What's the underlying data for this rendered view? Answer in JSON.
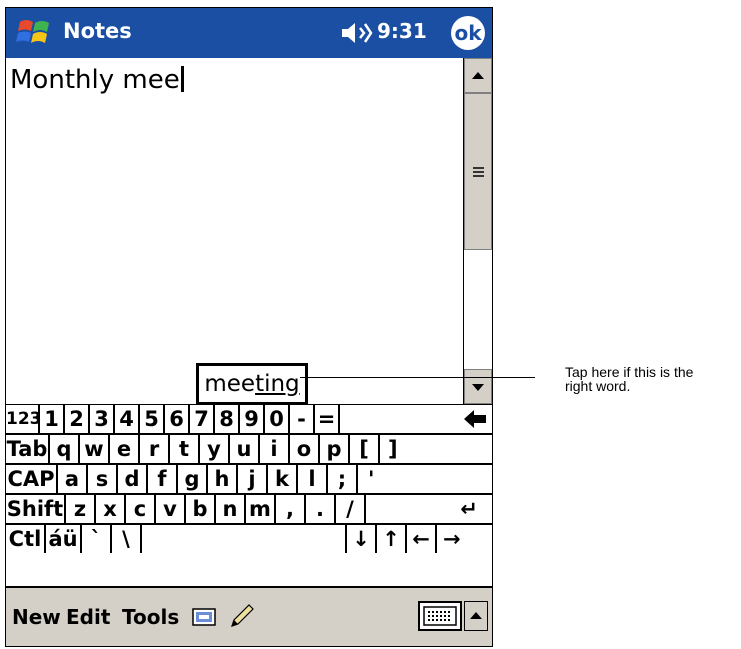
{
  "titlebar": {
    "app_title": "Notes",
    "time": "9:31",
    "ok_label": "ok"
  },
  "note": {
    "text": "Monthly mee"
  },
  "suggestion": {
    "prefix": "mee",
    "completion": "ting"
  },
  "keyboard": {
    "rows": [
      [
        "123",
        "1",
        "2",
        "3",
        "4",
        "5",
        "6",
        "7",
        "8",
        "9",
        "0",
        "-",
        "=",
        "←"
      ],
      [
        "Tab",
        "q",
        "w",
        "e",
        "r",
        "t",
        "y",
        "u",
        "i",
        "o",
        "p",
        "[",
        "]"
      ],
      [
        "CAP",
        "a",
        "s",
        "d",
        "f",
        "g",
        "h",
        "j",
        "k",
        "l",
        ";",
        "'"
      ],
      [
        "Shift",
        "z",
        "x",
        "c",
        "v",
        "b",
        "n",
        "m",
        ",",
        ".",
        "/",
        "↵"
      ],
      [
        "Ctl",
        "áü",
        "`",
        "\\",
        "",
        "↓",
        "↑",
        "←",
        "→"
      ]
    ]
  },
  "menubar": {
    "new": "New",
    "edit": "Edit",
    "tools": "Tools"
  },
  "icons": {
    "start": "windows-flag-icon",
    "speaker": "speaker-icon",
    "record": "recording-icon",
    "pen": "pen-icon",
    "keyboard": "keyboard-icon",
    "input_selector": "chevron-up-icon"
  },
  "colors": {
    "titlebar": "#1b4fa3",
    "menubar": "#d4d0c8"
  },
  "callout": {
    "line1": "Tap here if this is the",
    "line2": "right word."
  }
}
